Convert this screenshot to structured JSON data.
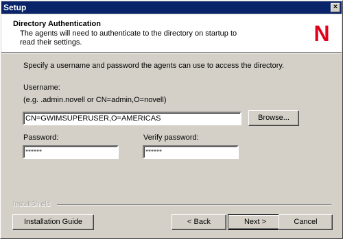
{
  "titlebar": {
    "title": "Setup",
    "close_glyph": "×"
  },
  "header": {
    "title": "Directory Authentication",
    "description": "The agents will need to authenticate to the directory on startup to read their settings.",
    "logo_letter": "N",
    "logo_color": "#e2001a"
  },
  "body": {
    "instruction": "Specify a username and password the agents can use to access the directory.",
    "username_label": "Username:",
    "username_example": "(e.g. .admin.novell or CN=admin,O=novell)",
    "username_value": "CN=GWIMSUPERUSER,O=AMERICAS",
    "browse_label": "Browse...",
    "password_label": "Password:",
    "password_value": "******",
    "verify_label": "Verify password:",
    "verify_value": "******"
  },
  "footer": {
    "installshield": "InstallShield",
    "guide_label": "Installation Guide",
    "back_label": "< Back",
    "next_label": "Next >",
    "cancel_label": "Cancel"
  }
}
